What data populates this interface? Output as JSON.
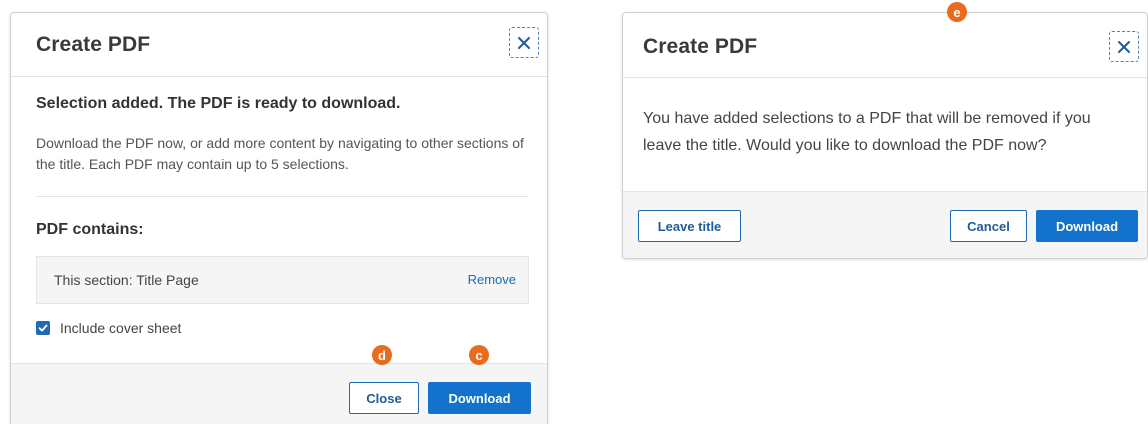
{
  "colors": {
    "accent": "#1272cc",
    "link": "#1f6ab4",
    "marker": "#ea6a1e"
  },
  "left_dialog": {
    "title": "Create PDF",
    "close_icon": "close-x-icon",
    "heading": "Selection added. The PDF is ready to download.",
    "description": "Download the PDF now, or add more content by navigating to other sections of the title. Each PDF may contain up to 5 selections.",
    "contains_heading": "PDF contains:",
    "selection": {
      "label": "This section: Title Page",
      "remove_label": "Remove"
    },
    "cover_sheet": {
      "label": "Include cover sheet",
      "checked": true
    },
    "footer": {
      "close_label": "Close",
      "download_label": "Download"
    }
  },
  "right_dialog": {
    "title": "Create PDF",
    "close_icon": "close-x-icon",
    "message": "You have added selections to a PDF that will be removed if you leave the title. Would you like to download the PDF now?",
    "footer": {
      "leave_label": "Leave title",
      "cancel_label": "Cancel",
      "download_label": "Download"
    }
  },
  "markers": {
    "c": "c",
    "d": "d",
    "e": "e"
  }
}
